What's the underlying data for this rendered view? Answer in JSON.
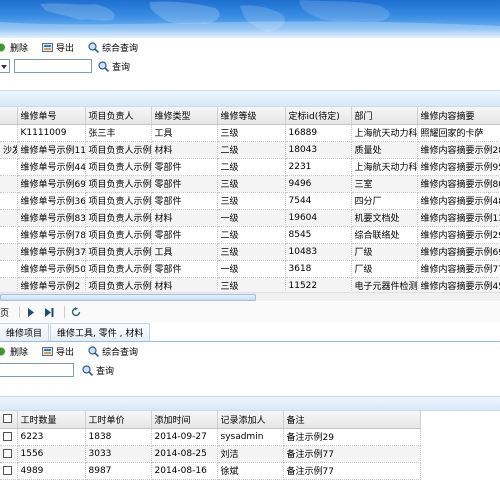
{
  "banner": {
    "image": "world-map"
  },
  "toolbar1": {
    "delete_label": "删除",
    "export_label": "导出",
    "query_label": "综合查询"
  },
  "search1": {
    "value": "",
    "button_label": "查询"
  },
  "grid1": {
    "columns": [
      "维修单号",
      "项目负责人",
      "维修类型",
      "维修等级",
      "定标id(待定)",
      "部门",
      "维修内容摘要"
    ],
    "rows": [
      {
        "pre": "",
        "cells": [
          "K1111009",
          "张三丰",
          "工具",
          "三级",
          "16889",
          "上海航天动力科技",
          "照耀回家的卡萨"
        ]
      },
      {
        "pre": "沙发",
        "cells": [
          "维修单号示例11",
          "项目负责人示例T3",
          "材料",
          "二级",
          "18043",
          "质量处",
          "维修内容摘要示例28"
        ]
      },
      {
        "pre": "",
        "cells": [
          "维修单号示例44",
          "项目负责人示例47",
          "零部件",
          "二级",
          "2231",
          "上海航天动力科技",
          "维修内容摘要示例95"
        ]
      },
      {
        "pre": "",
        "cells": [
          "维修单号示例69",
          "项目负责人示例29",
          "零部件",
          "三级",
          "9496",
          "三室",
          "维修内容摘要示例80"
        ]
      },
      {
        "pre": "",
        "cells": [
          "维修单号示例36",
          "项目负责人示例81",
          "零部件",
          "三级",
          "7544",
          "四分厂",
          "维修内容摘要示例48"
        ]
      },
      {
        "pre": "",
        "cells": [
          "维修单号示例83",
          "项目负责人示例35",
          "材料",
          "一级",
          "19604",
          "机要文档处",
          "维修内容摘要示例13"
        ]
      },
      {
        "pre": "",
        "cells": [
          "维修单号示例78",
          "项目负责人示例69",
          "零部件",
          "二级",
          "8545",
          "综合联络处",
          "维修内容摘要示例29"
        ]
      },
      {
        "pre": "",
        "cells": [
          "维修单号示例37",
          "项目负责人示例26",
          "工具",
          "三级",
          "10483",
          "厂级",
          "维修内容摘要示例69"
        ]
      },
      {
        "pre": "",
        "cells": [
          "维修单号示例50",
          "项目负责人示例T2",
          "零部件",
          "一级",
          "3618",
          "厂级",
          "维修内容摘要示例77"
        ]
      },
      {
        "pre": "",
        "cells": [
          "维修单号示例2",
          "项目负责人示例19",
          "材料",
          "三级",
          "11522",
          "电子元器件检测与",
          "维修内容摘要示例45"
        ]
      }
    ]
  },
  "pager": {
    "page_label": "页"
  },
  "tabs": [
    {
      "label": "维修项目"
    },
    {
      "label": "维修工具, 零件 , 材料"
    }
  ],
  "toolbar2": {
    "delete_label": "删除",
    "export_label": "导出",
    "query_label": "综合查询"
  },
  "search2": {
    "value": "",
    "button_label": "查询"
  },
  "grid2": {
    "columns": [
      "工时数量",
      "工时单价",
      "添加时间",
      "记录添加人",
      "备注"
    ],
    "rows": [
      {
        "cells": [
          "6223",
          "1838",
          "2014-09-27",
          "sysadmin",
          "备注示例29"
        ]
      },
      {
        "cells": [
          "1556",
          "3033",
          "2014-08-25",
          "刘洁",
          "备注示例77"
        ]
      },
      {
        "cells": [
          "4989",
          "8987",
          "2014-08-16",
          "徐斌",
          "备注示例77"
        ]
      }
    ]
  },
  "colors": {
    "accent": "#1e6fd0",
    "tab_border": "#99bbe8",
    "header_bg": "#e6e6e6"
  }
}
